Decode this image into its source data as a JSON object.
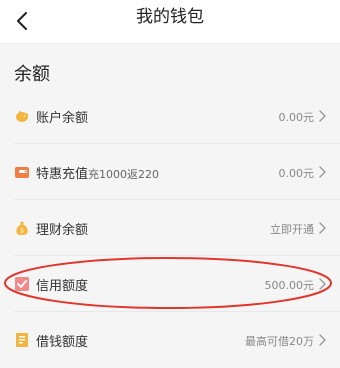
{
  "header": {
    "title": "我的钱包"
  },
  "section": {
    "title": "余额"
  },
  "rows": [
    {
      "label": "账户余额",
      "sub": "",
      "value": "0.00元"
    },
    {
      "label": "特惠充值",
      "sub": "充1000返220",
      "value": "0.00元"
    },
    {
      "label": "理财余额",
      "sub": "",
      "value": "立即开通"
    },
    {
      "label": "信用额度",
      "sub": "",
      "value": "500.00元"
    },
    {
      "label": "借钱额度",
      "sub": "",
      "value": "最高可借20万"
    }
  ],
  "colors": {
    "accent": "#f27d45",
    "highlight": "#e0362b",
    "credit_icon": "#f08a8a",
    "gold": "#f3b53f"
  },
  "icons": [
    "back-chevron-icon",
    "piggy-bank-icon",
    "wallet-icon",
    "money-bag-icon",
    "checkbox-icon",
    "loan-card-icon",
    "chevron-right-icon"
  ]
}
